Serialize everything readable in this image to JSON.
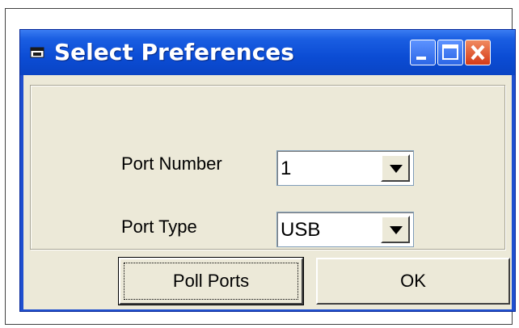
{
  "window": {
    "title": "Select Preferences"
  },
  "fields": {
    "port_number_label": "Port Number",
    "port_number_value": "1",
    "port_type_label": "Port Type",
    "port_type_value": "USB"
  },
  "buttons": {
    "poll_ports": "Poll Ports",
    "ok": "OK"
  },
  "icons": {
    "window_icon": "window-app-icon",
    "minimize": "minimize-icon",
    "maximize": "maximize-icon",
    "close": "close-icon",
    "dropdown": "chevron-down-icon"
  },
  "colors": {
    "titlebar": "#0b4cd4",
    "client": "#ece9d8",
    "close_button": "#d43a18"
  }
}
